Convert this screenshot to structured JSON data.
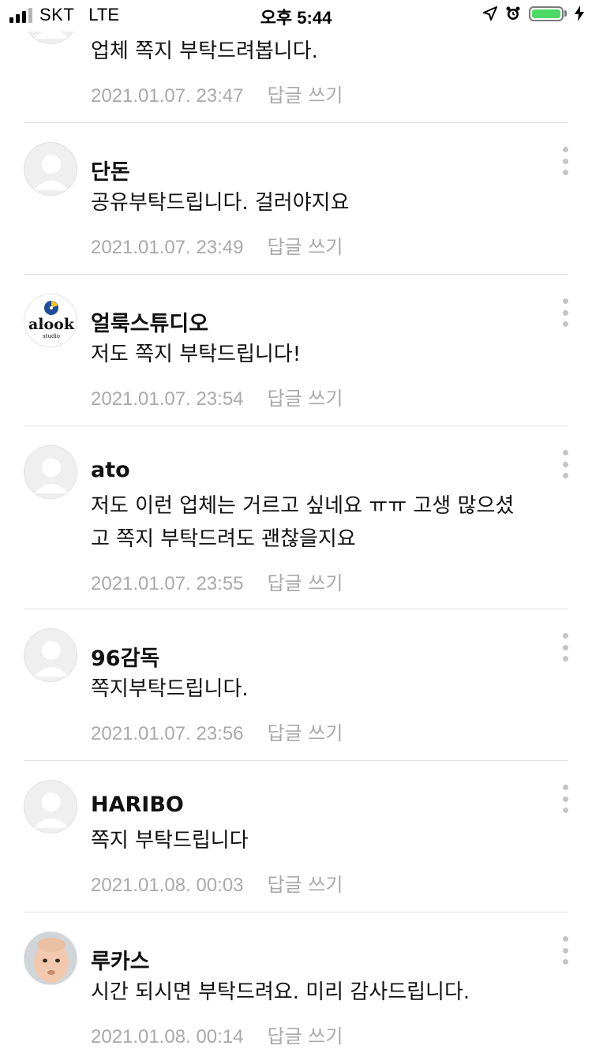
{
  "status_bar": {
    "carrier": "SKT",
    "network": "LTE",
    "time": "오후 5:44",
    "battery_color": "#4cd964"
  },
  "reply_label": "답글 쓰기",
  "comments": [
    {
      "author": "",
      "text": "업체 쪽지 부탁드려봅니다.",
      "date": "2021.01.07. 23:47",
      "avatar": "default-avatar"
    },
    {
      "author": "단돈",
      "text": "공유부탁드립니다. 걸러야지요",
      "date": "2021.01.07. 23:49",
      "avatar": "default-avatar"
    },
    {
      "author": "얼룩스튜디오",
      "text": "저도 쪽지 부탁드립니다!",
      "date": "2021.01.07. 23:54",
      "avatar": "alook-logo",
      "avatar_text": "alook",
      "avatar_subtext": "studio"
    },
    {
      "author": "ato",
      "text_line1": "저도 이런 업체는 거르고 싶네요 ㅠㅠ 고생 많으셨",
      "text_line2": "고 쪽지 부탁드려도 괜찮을지요",
      "date": "2021.01.07. 23:55",
      "avatar": "default-avatar"
    },
    {
      "author": "96감독",
      "text": "쪽지부탁드립니다.",
      "date": "2021.01.07. 23:56",
      "avatar": "default-avatar"
    },
    {
      "author": "HARIBO",
      "text": "쪽지 부탁드립니다",
      "date": "2021.01.08. 00:03",
      "avatar": "default-avatar"
    },
    {
      "author": "루카스",
      "text": "시간 되시면 부탁드려요. 미리 감사드립니다.",
      "date": "2021.01.08. 00:14",
      "avatar": "baby-photo"
    }
  ]
}
